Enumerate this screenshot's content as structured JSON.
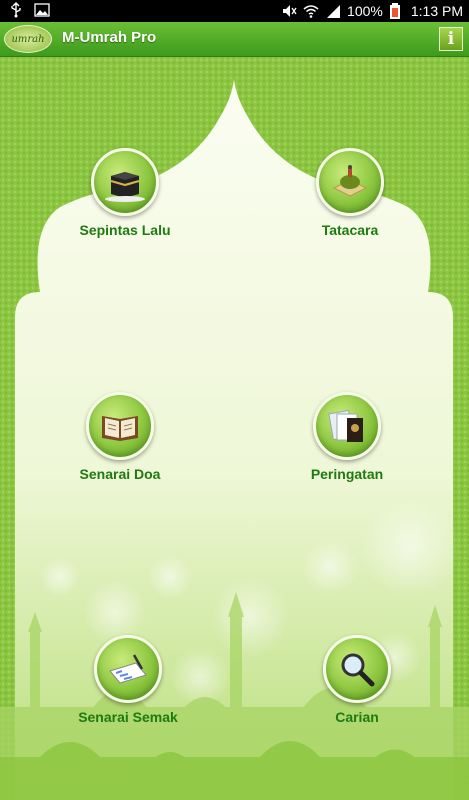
{
  "status_bar": {
    "battery": "100%",
    "time": "1:13 PM"
  },
  "action_bar": {
    "logo_text": "umrah",
    "title": "M-Umrah Pro",
    "info_icon": "info-icon"
  },
  "menu": {
    "items": [
      {
        "label": "Sepintas Lalu",
        "icon": "kaaba-icon"
      },
      {
        "label": "Tatacara",
        "icon": "prayer-mat-icon"
      },
      {
        "label": "Senarai Doa",
        "icon": "book-icon"
      },
      {
        "label": "Peringatan",
        "icon": "documents-icon"
      },
      {
        "label": "Senarai Semak",
        "icon": "checklist-icon"
      },
      {
        "label": "Carian",
        "icon": "search-icon"
      }
    ]
  },
  "colors": {
    "accent": "#8cc63f",
    "label": "#1f7a10",
    "actionbar": "#4fab27"
  }
}
